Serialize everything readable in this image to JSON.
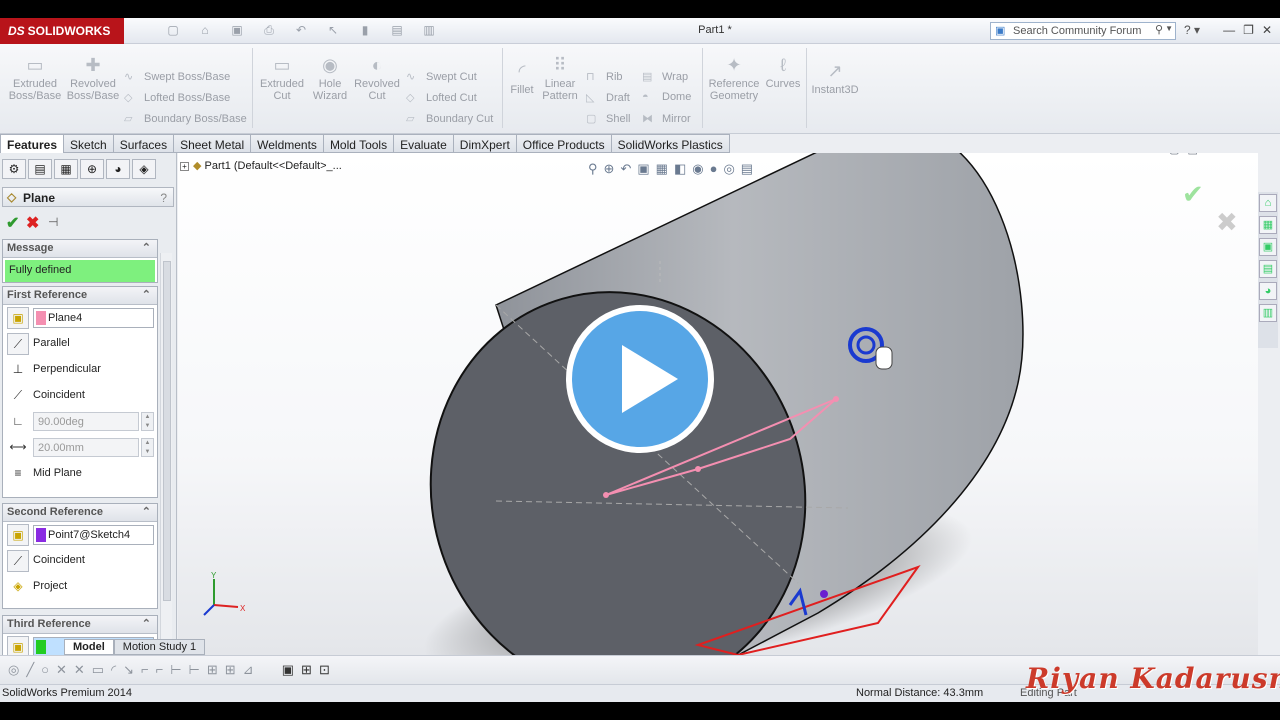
{
  "app": {
    "brand": "SOLIDWORKS",
    "brand_prefix": "DS",
    "doc_title": "Part1 *",
    "search_placeholder": "Search Community Forum"
  },
  "toolbar": {
    "extruded_boss": "Extruded Boss/Base",
    "revolved_boss": "Revolved Boss/Base",
    "swept_boss": "Swept Boss/Base",
    "lofted_boss": "Lofted Boss/Base",
    "boundary_boss": "Boundary Boss/Base",
    "extruded_cut": "Extruded Cut",
    "hole_wizard": "Hole Wizard",
    "revolved_cut": "Revolved Cut",
    "swept_cut": "Swept Cut",
    "lofted_cut": "Lofted Cut",
    "boundary_cut": "Boundary Cut",
    "fillet": "Fillet",
    "linear_pattern": "Linear Pattern",
    "rib": "Rib",
    "draft": "Draft",
    "shell": "Shell",
    "wrap": "Wrap",
    "dome": "Dome",
    "mirror": "Mirror",
    "reference_geometry": "Reference Geometry",
    "curves": "Curves",
    "instant3d": "Instant3D"
  },
  "tabs": [
    "Features",
    "Sketch",
    "Surfaces",
    "Sheet Metal",
    "Weldments",
    "Mold Tools",
    "Evaluate",
    "DimXpert",
    "Office Products",
    "SolidWorks Plastics"
  ],
  "property_manager": {
    "title": "Plane",
    "message_header": "Message",
    "message": "Fully defined",
    "first_ref": {
      "header": "First Reference",
      "selection": "Plane4",
      "selection_color": "#f48fb1",
      "parallel": "Parallel",
      "perpendicular": "Perpendicular",
      "coincident": "Coincident",
      "angle": "90.00deg",
      "distance": "20.00mm",
      "mid_plane": "Mid Plane"
    },
    "second_ref": {
      "header": "Second Reference",
      "selection": "Point7@Sketch4",
      "selection_color": "#8a2be2",
      "coincident": "Coincident",
      "project": "Project"
    },
    "third_ref": {
      "header": "Third Reference",
      "selection": "",
      "selection_color": "#22cc22"
    }
  },
  "viewport": {
    "tree_label": "Part1  (Default<<Default>_..."
  },
  "bottom_tabs": [
    "Model",
    "Motion Study 1"
  ],
  "status": {
    "app_version": "SolidWorks Premium 2014",
    "normal_distance": "Normal Distance: 43.3mm",
    "editing": "Editing Part"
  },
  "watermark": "Riyan Kadarusman"
}
